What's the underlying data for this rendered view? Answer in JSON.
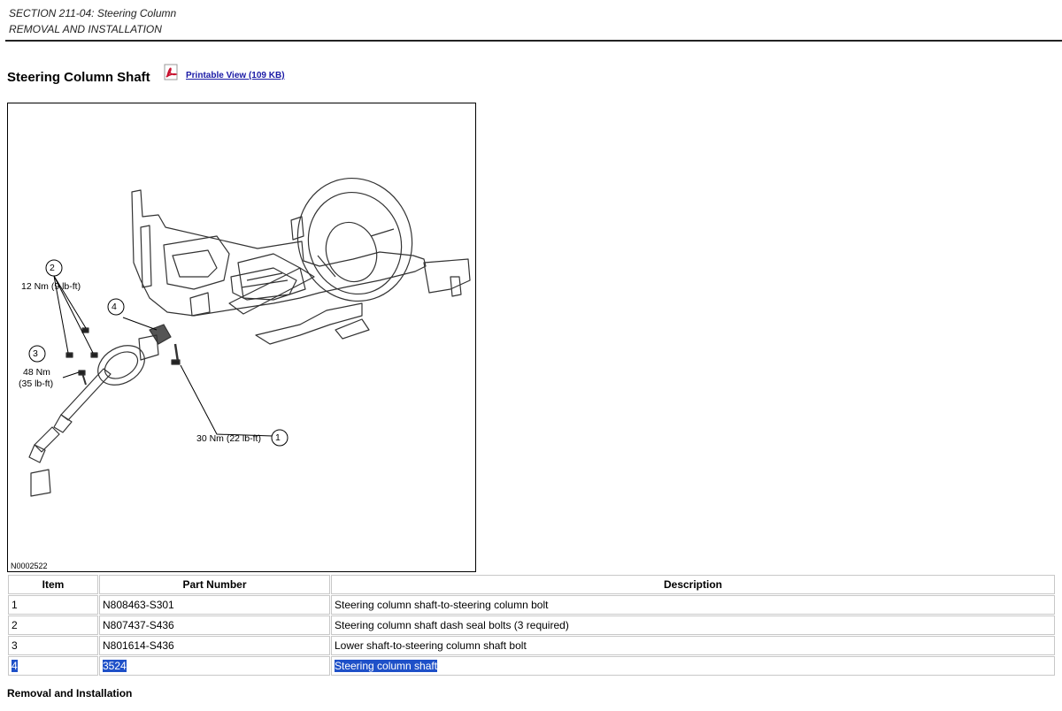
{
  "header": {
    "section": "SECTION 211-04: Steering Column",
    "subsection": "REMOVAL AND INSTALLATION"
  },
  "page": {
    "title": "Steering Column Shaft",
    "printable_link": "Printable View (109 KB)"
  },
  "figure": {
    "id": "N0002522",
    "callouts": {
      "c1": {
        "number": "1",
        "torque": "30 Nm (22 lb-ft)"
      },
      "c2": {
        "number": "2",
        "torque": "12 Nm (9 lb-ft)"
      },
      "c3": {
        "number": "3",
        "torque_line1": "48 Nm",
        "torque_line2": "(35 lb-ft)"
      },
      "c4": {
        "number": "4"
      }
    }
  },
  "parts_table": {
    "headers": {
      "item": "Item",
      "part_number": "Part Number",
      "description": "Description"
    },
    "rows": [
      {
        "item": "1",
        "part_number": "N808463-S301",
        "description": "Steering column shaft-to-steering column bolt"
      },
      {
        "item": "2",
        "part_number": "N807437-S436",
        "description": "Steering column shaft dash seal bolts (3 required)"
      },
      {
        "item": "3",
        "part_number": "N801614-S436",
        "description": "Lower shaft-to-steering column shaft bolt"
      },
      {
        "item": "4",
        "part_number": "3524",
        "description": "Steering column shaft"
      }
    ]
  },
  "footer": {
    "subheading": "Removal and Installation"
  },
  "colors": {
    "link": "#1a1aa6",
    "selection": "#1e50c8",
    "pdf_icon": "#c8102e"
  }
}
